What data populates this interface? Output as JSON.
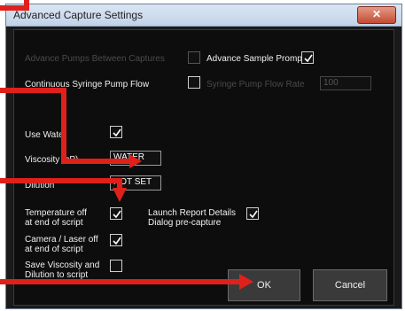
{
  "window": {
    "title": "Advanced Capture Settings",
    "close_icon": "✕"
  },
  "options": {
    "advance_pumps": {
      "label": "Advance Pumps Between Captures",
      "checked": false,
      "enabled": false
    },
    "advance_sample_prompt": {
      "label": "Advance Sample Prompt",
      "checked": true
    },
    "continuous_syringe": {
      "label": "Continuous Syringe Pump Flow",
      "checked": false
    },
    "syringe_flow_rate": {
      "label": "Syringe Pump Flow Rate",
      "value": "100",
      "enabled": false
    },
    "use_water": {
      "label": "Use Water",
      "checked": true
    },
    "viscosity": {
      "label": "Viscosity (cP)",
      "value": "WATER"
    },
    "dilution": {
      "label": "Dilution",
      "value": "NOT SET"
    },
    "temperature_off": {
      "line1": "Temperature off",
      "line2": "at end of script",
      "checked": true
    },
    "camera_laser_off": {
      "line1": "Camera / Laser off",
      "line2": "at end of script",
      "checked": true
    },
    "save_viscosity": {
      "line1": "Save Viscosity and",
      "line2": "Dilution to script",
      "checked": false
    },
    "launch_report": {
      "line1": "Launch Report Details",
      "line2": "Dialog pre-capture",
      "checked": true
    }
  },
  "buttons": {
    "ok": "OK",
    "cancel": "Cancel"
  },
  "colors": {
    "annotation_arrow": "#e0201b",
    "dialog_bg": "#0d0d0d"
  },
  "icons": {
    "checkmark": "check-icon",
    "close": "close-icon",
    "annotation": "red-arrow"
  }
}
